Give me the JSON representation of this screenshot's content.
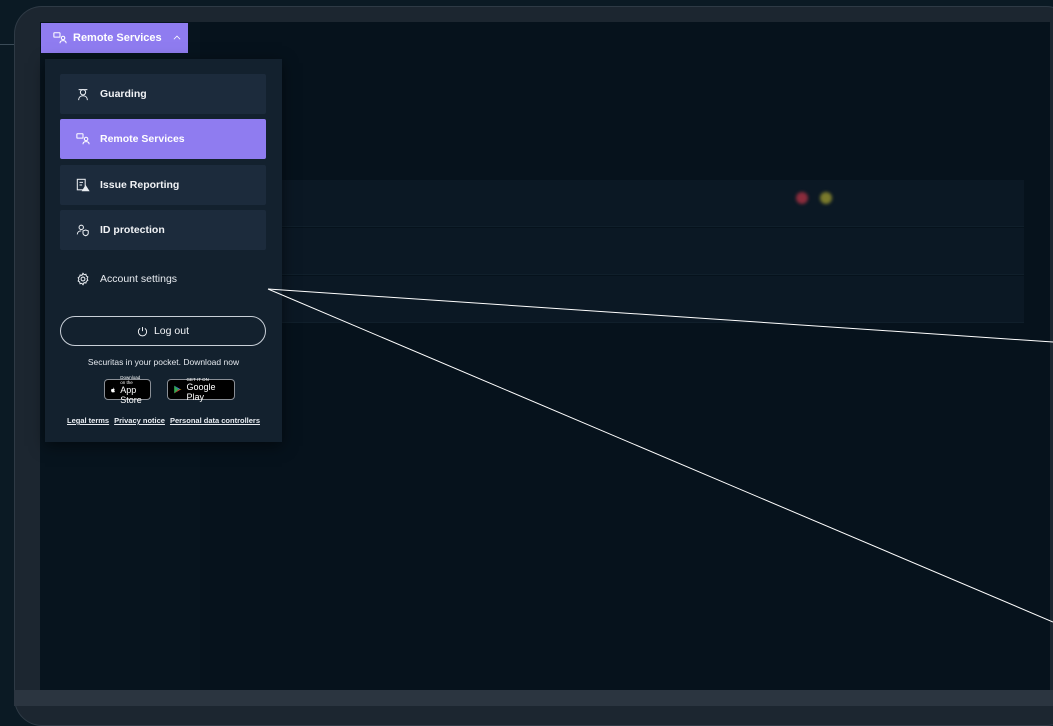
{
  "header": {
    "trigger_label": "Remote Services"
  },
  "menu": {
    "items": [
      {
        "label": "Guarding",
        "icon": "guard-icon"
      },
      {
        "label": "Remote Services",
        "icon": "remote-services-icon",
        "active": true
      },
      {
        "label": "Issue Reporting",
        "icon": "issue-report-icon"
      },
      {
        "label": "ID protection",
        "icon": "id-protection-icon"
      }
    ],
    "account_settings": "Account settings",
    "logout": "Log out",
    "promo": "Securitas in your pocket. Download now",
    "app_store": {
      "small": "Download on the",
      "big": "App Store"
    },
    "google_play": {
      "small": "GET IT ON",
      "big": "Google Play"
    },
    "links": [
      "Legal terms",
      "Privacy notice",
      "Personal data controllers"
    ]
  },
  "colors": {
    "accent": "#8f7cf0",
    "panel": "#13212e",
    "item": "#1c2b3c"
  }
}
